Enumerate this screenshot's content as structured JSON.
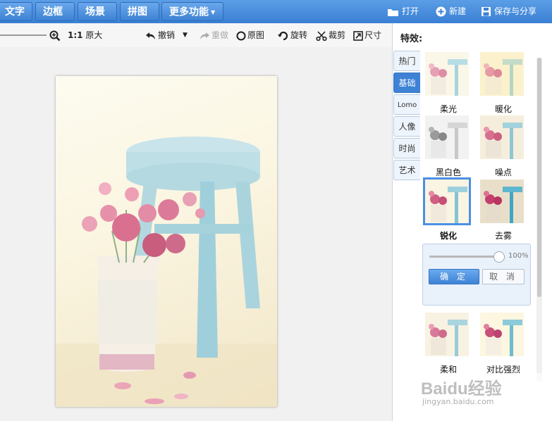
{
  "topbar": {
    "tabs": [
      {
        "label": "文字"
      },
      {
        "label": "边框"
      },
      {
        "label": "场景"
      },
      {
        "label": "拼图"
      },
      {
        "label": "更多功能"
      }
    ],
    "open_label": "打开",
    "new_label": "新建",
    "save_label": "保存与分享"
  },
  "toolbar": {
    "ratio_label": "1:1",
    "original_size_label": "原大",
    "undo_label": "撤销",
    "redo_label": "重做",
    "original_label": "原图",
    "rotate_label": "旋转",
    "crop_label": "裁剪",
    "size_label": "尺寸"
  },
  "effects_panel": {
    "title": "特效:",
    "categories": [
      {
        "label": "热门",
        "active": false
      },
      {
        "label": "基础",
        "active": true
      },
      {
        "label": "Lomo",
        "active": false
      },
      {
        "label": "人像",
        "active": false
      },
      {
        "label": "时尚",
        "active": false
      },
      {
        "label": "艺术",
        "active": false
      }
    ],
    "effects": [
      {
        "label": "柔光"
      },
      {
        "label": "暖化"
      },
      {
        "label": "黑白色"
      },
      {
        "label": "噪点"
      },
      {
        "label": "锐化",
        "selected": true
      },
      {
        "label": "去雾"
      },
      {
        "label": "柔和"
      },
      {
        "label": "对比强烈"
      }
    ],
    "intensity_percent": "100%",
    "intensity_value": 1.0,
    "confirm_label": "确 定",
    "cancel_label": "取 消"
  },
  "watermark": {
    "line1": "Baidu经验",
    "line2": "jingyan.baidu.com"
  },
  "colors": {
    "accent": "#3d82d4",
    "topbar": "#4a8fe0"
  }
}
